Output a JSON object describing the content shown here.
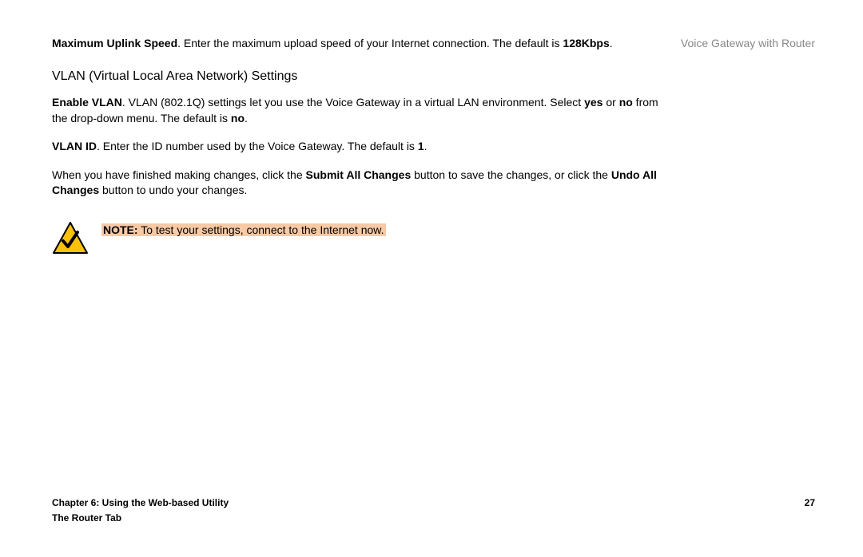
{
  "header": {
    "product_title": "Voice Gateway with Router"
  },
  "content": {
    "uplink_para_a": "Maximum Uplink Speed",
    "uplink_para_b": ". Enter the maximum upload speed of your Internet connection. The default is ",
    "uplink_default": "128Kbps",
    "uplink_para_c": ".",
    "vlan_heading": "VLAN (Virtual Local Area Network) Settings",
    "vlan_enable_a": "Enable VLAN",
    "vlan_enable_b": ". VLAN (802.1Q) settings let you use the Voice Gateway in a virtual LAN environment. Select ",
    "vlan_enable_yes": "yes",
    "vlan_enable_c": " or ",
    "vlan_enable_no": "no",
    "vlan_enable_d": " from the drop-down menu. The default is ",
    "vlan_enable_default": "no",
    "vlan_enable_e": ".",
    "vlan_id_a": "VLAN ID",
    "vlan_id_b": ". Enter the ID number used by the Voice Gateway. The default is ",
    "vlan_id_default": "1",
    "vlan_id_c": ".",
    "submit_a": "When you have finished making changes, click the ",
    "submit_btn": "Submit All Changes",
    "submit_b": " button to save the changes, or click the ",
    "undo_btn": "Undo All Changes",
    "submit_c": " button to undo your changes.",
    "note_label": "NOTE:",
    "note_text": "To test your settings, connect to the Internet now."
  },
  "footer": {
    "chapter": "Chapter 6: Using the Web-based Utility",
    "page_number": "27",
    "section": "The Router Tab"
  }
}
